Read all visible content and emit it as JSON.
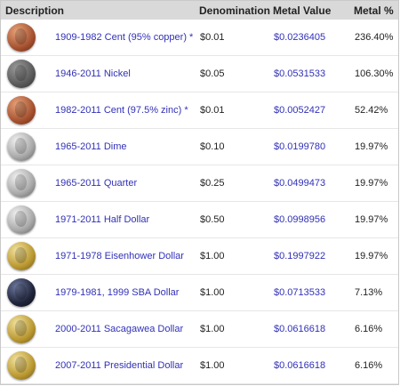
{
  "header": {
    "description": "Description",
    "denomination": "Denomination",
    "metal_value": "Metal Value",
    "metal_pct": "Metal %"
  },
  "rows": [
    {
      "description": "1909-1982 Cent (95% copper) *",
      "denomination": "$0.01",
      "metal_value": "$0.0236405",
      "metal_pct": "236.40%",
      "icon": "penny-copper-icon"
    },
    {
      "description": "1946-2011 Nickel",
      "denomination": "$0.05",
      "metal_value": "$0.0531533",
      "metal_pct": "106.30%",
      "icon": "nickel-icon"
    },
    {
      "description": "1982-2011 Cent (97.5% zinc) *",
      "denomination": "$0.01",
      "metal_value": "$0.0052427",
      "metal_pct": "52.42%",
      "icon": "penny-zinc-icon"
    },
    {
      "description": "1965-2011 Dime",
      "denomination": "$0.10",
      "metal_value": "$0.0199780",
      "metal_pct": "19.97%",
      "icon": "dime-icon"
    },
    {
      "description": "1965-2011 Quarter",
      "denomination": "$0.25",
      "metal_value": "$0.0499473",
      "metal_pct": "19.97%",
      "icon": "quarter-icon"
    },
    {
      "description": "1971-2011 Half Dollar",
      "denomination": "$0.50",
      "metal_value": "$0.0998956",
      "metal_pct": "19.97%",
      "icon": "half-dollar-icon"
    },
    {
      "description": "1971-1978 Eisenhower Dollar",
      "denomination": "$1.00",
      "metal_value": "$0.1997922",
      "metal_pct": "19.97%",
      "icon": "eisenhower-dollar-icon"
    },
    {
      "description": "1979-1981, 1999 SBA Dollar",
      "denomination": "$1.00",
      "metal_value": "$0.0713533",
      "metal_pct": "7.13%",
      "icon": "sba-dollar-icon"
    },
    {
      "description": "2000-2011 Sacagawea Dollar",
      "denomination": "$1.00",
      "metal_value": "$0.0616618",
      "metal_pct": "6.16%",
      "icon": "sacagawea-dollar-icon"
    },
    {
      "description": "2007-2011 Presidential Dollar",
      "denomination": "$1.00",
      "metal_value": "$0.0616618",
      "metal_pct": "6.16%",
      "icon": "presidential-dollar-icon"
    }
  ]
}
